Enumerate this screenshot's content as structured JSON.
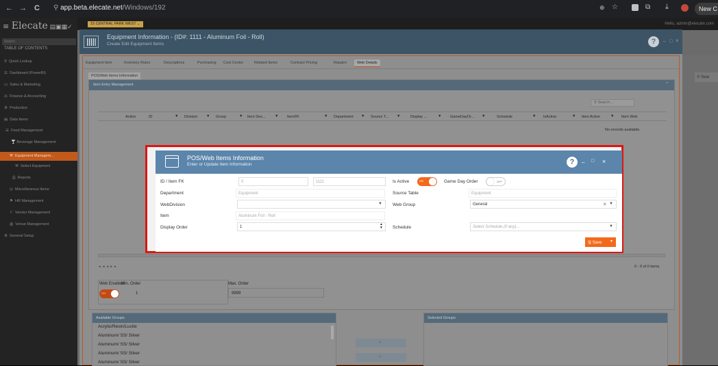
{
  "browser": {
    "back": "←",
    "forward": "→",
    "reload": "C",
    "url_domain": "app.beta.elecate.net",
    "url_path": "/Windows/192",
    "new_chrome": "New C"
  },
  "app": {
    "logo": "Elecate",
    "location": "15 CENTRAL PARK WEST ⌄",
    "hello": "Hello, admin@elecate.com",
    "search_placeholder": "Search",
    "toc": "TABLE OF CONTENTS",
    "sidebar": [
      "Quick Lookup",
      "Dashboard (PowerBI)",
      "Sales & Marketing",
      "Finance & Accounting",
      "Production",
      "Data Items",
      "Food Management",
      "Beverage Management",
      "Equipment Managem...",
      "Select Equipment",
      "Reports",
      "Miscellaneous Items",
      "HR Management",
      "Vendor Management",
      "Venue Management",
      "General Setup"
    ],
    "right_search": "Sear"
  },
  "main": {
    "title": "Equipment Information - (ID#: 1111 - Aluminum Foil - Roll)",
    "subtitle": "Create Edit Equipment Items",
    "tabs": [
      "Equipment Item",
      "Inventory Rules",
      "Descriptions",
      "Purchasing",
      "Cost Center",
      "Related Items",
      "Contract Pricing",
      "Repairs",
      "Web Details"
    ],
    "subtab": "POS/Web Items Information",
    "panel_title": "Item Entry Management",
    "grid_search": "Search...",
    "columns": [
      "Action",
      "ID",
      "Division",
      "Group",
      "Item Des...",
      "ItemFK",
      "Department",
      "Source T...",
      "Display ...",
      "GameDayOr...",
      "Schedule",
      "IsActive",
      "Item Active",
      "Item Web"
    ],
    "no_records": "No records available.",
    "pager_text": "0 - 0 of 0 items",
    "web_enabled_label": "Web Enabled",
    "min_order_label": "Min. Order",
    "max_order_label": "Max. Order",
    "min_order": "1",
    "max_order": "9999",
    "toggle_on": "ON",
    "available_groups": "Available Groups",
    "selected_groups": "Selected Groups",
    "groups": [
      "Acrylic/Resin/Lucite",
      "Aluminum/ SS/ Silver",
      "Aluminum/ SS/ Silver",
      "Aluminum/ SS/ Silver",
      "Aluminum/ SS/ Silver",
      "Aluminum/ SS/ Silver",
      "Aluminum/ SS/ Silver"
    ],
    "move_right": "»",
    "move_left": "«"
  },
  "popup": {
    "title": "POS/Web Items Information",
    "subtitle": "Enter or Update Item Information",
    "help": "?",
    "minimize": "–",
    "maximize": "□",
    "close": "×",
    "id_label": "ID / Item FK",
    "id_value": "0",
    "item_fk_value": "1111",
    "is_active_label": "Is Active",
    "is_active_state": "ON",
    "game_day_label": "Game Day Order",
    "game_day_state": "OFF",
    "department_label": "Department",
    "department_value": "Equipment",
    "source_table_label": "Source Table",
    "source_table_value": "Equipment",
    "webdivision_label": "WebDivision",
    "webdivision_value": "",
    "web_group_label": "Web Group",
    "web_group_value": "General",
    "item_label": "Item",
    "item_value": "Aluminum Foil - Roll",
    "display_order_label": "Display Order",
    "display_order_value": "1",
    "schedule_label": "Schedule",
    "schedule_placeholder": "Select Schedule (if any)...",
    "save_label": "Save",
    "accent": "#5b85ab",
    "save_color": "#f26a1b",
    "toggle_on_color": "#f26a1b"
  }
}
